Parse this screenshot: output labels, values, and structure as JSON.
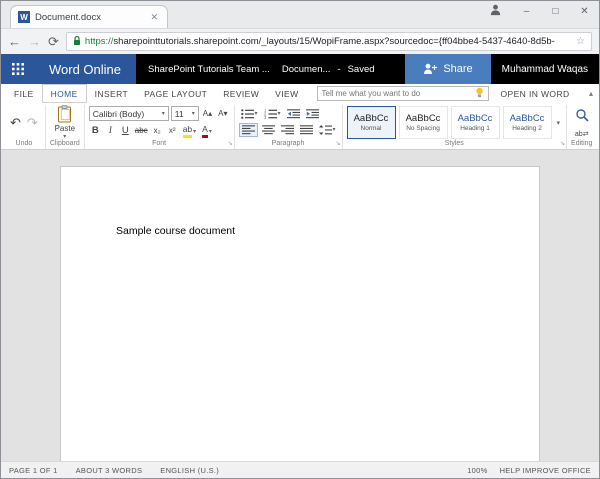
{
  "browser": {
    "tab_title": "Document.docx",
    "url_scheme": "https://",
    "url_rest": "sharepointtutorials.sharepoint.com/_layouts/15/WopiFrame.aspx?sourcedoc={ff04bbe4-5437-4640-8d5b-"
  },
  "suitebar": {
    "app_name": "Word Online",
    "site_label": "SharePoint Tutorials Team ...",
    "doc_label": "Documen...",
    "separator": "-",
    "saved_label": "Saved",
    "share_label": "Share",
    "user_name": "Muhammad Waqas"
  },
  "ribbon": {
    "tabs": {
      "file": "FILE",
      "home": "HOME",
      "insert": "INSERT",
      "page_layout": "PAGE LAYOUT",
      "review": "REVIEW",
      "view": "VIEW"
    },
    "tellme_placeholder": "Tell me what you want to do",
    "open_in_word": "OPEN IN WORD",
    "paste_label": "Paste",
    "font": {
      "name": "Calibri (Body)",
      "size": "11",
      "grow": "A▴",
      "shrink": "A▾",
      "bold": "B",
      "italic": "I",
      "underline": "U",
      "strike": "abc",
      "sub": "x₂",
      "sup": "x²",
      "highlight": "ab",
      "color": "A"
    },
    "styles": [
      {
        "preview": "AaBbCc",
        "name": "Normal"
      },
      {
        "preview": "AaBbCc",
        "name": "No Spacing"
      },
      {
        "preview": "AaBbCc",
        "name": "Heading 1"
      },
      {
        "preview": "AaBbCc",
        "name": "Heading 2"
      }
    ],
    "groups": {
      "undo": "Undo",
      "clipboard": "Clipboard",
      "font": "Font",
      "paragraph": "Paragraph",
      "styles": "Styles",
      "editing": "Editing"
    }
  },
  "document": {
    "body_text": "Sample course document"
  },
  "statusbar": {
    "page": "PAGE 1 OF 1",
    "words": "ABOUT 3 WORDS",
    "language": "ENGLISH (U.S.)",
    "zoom": "100%",
    "help": "HELP IMPROVE OFFICE"
  },
  "icons": {
    "word": "W",
    "tab_close": "✕",
    "minimize": "–",
    "maximize": "□",
    "close": "✕",
    "back": "←",
    "forward": "→",
    "refresh": "⟳",
    "star": "☆",
    "undo": "↶",
    "redo": "↷",
    "dropdown": "▾",
    "launcher": "↘",
    "collapse": "▴",
    "replace": "ab⇄"
  },
  "colors": {
    "accent": "#2b579a",
    "share_button": "#4a7dbe",
    "secure_url": "#188038",
    "highlight_yellow": "#ffe400",
    "font_color_red": "#c00000"
  }
}
